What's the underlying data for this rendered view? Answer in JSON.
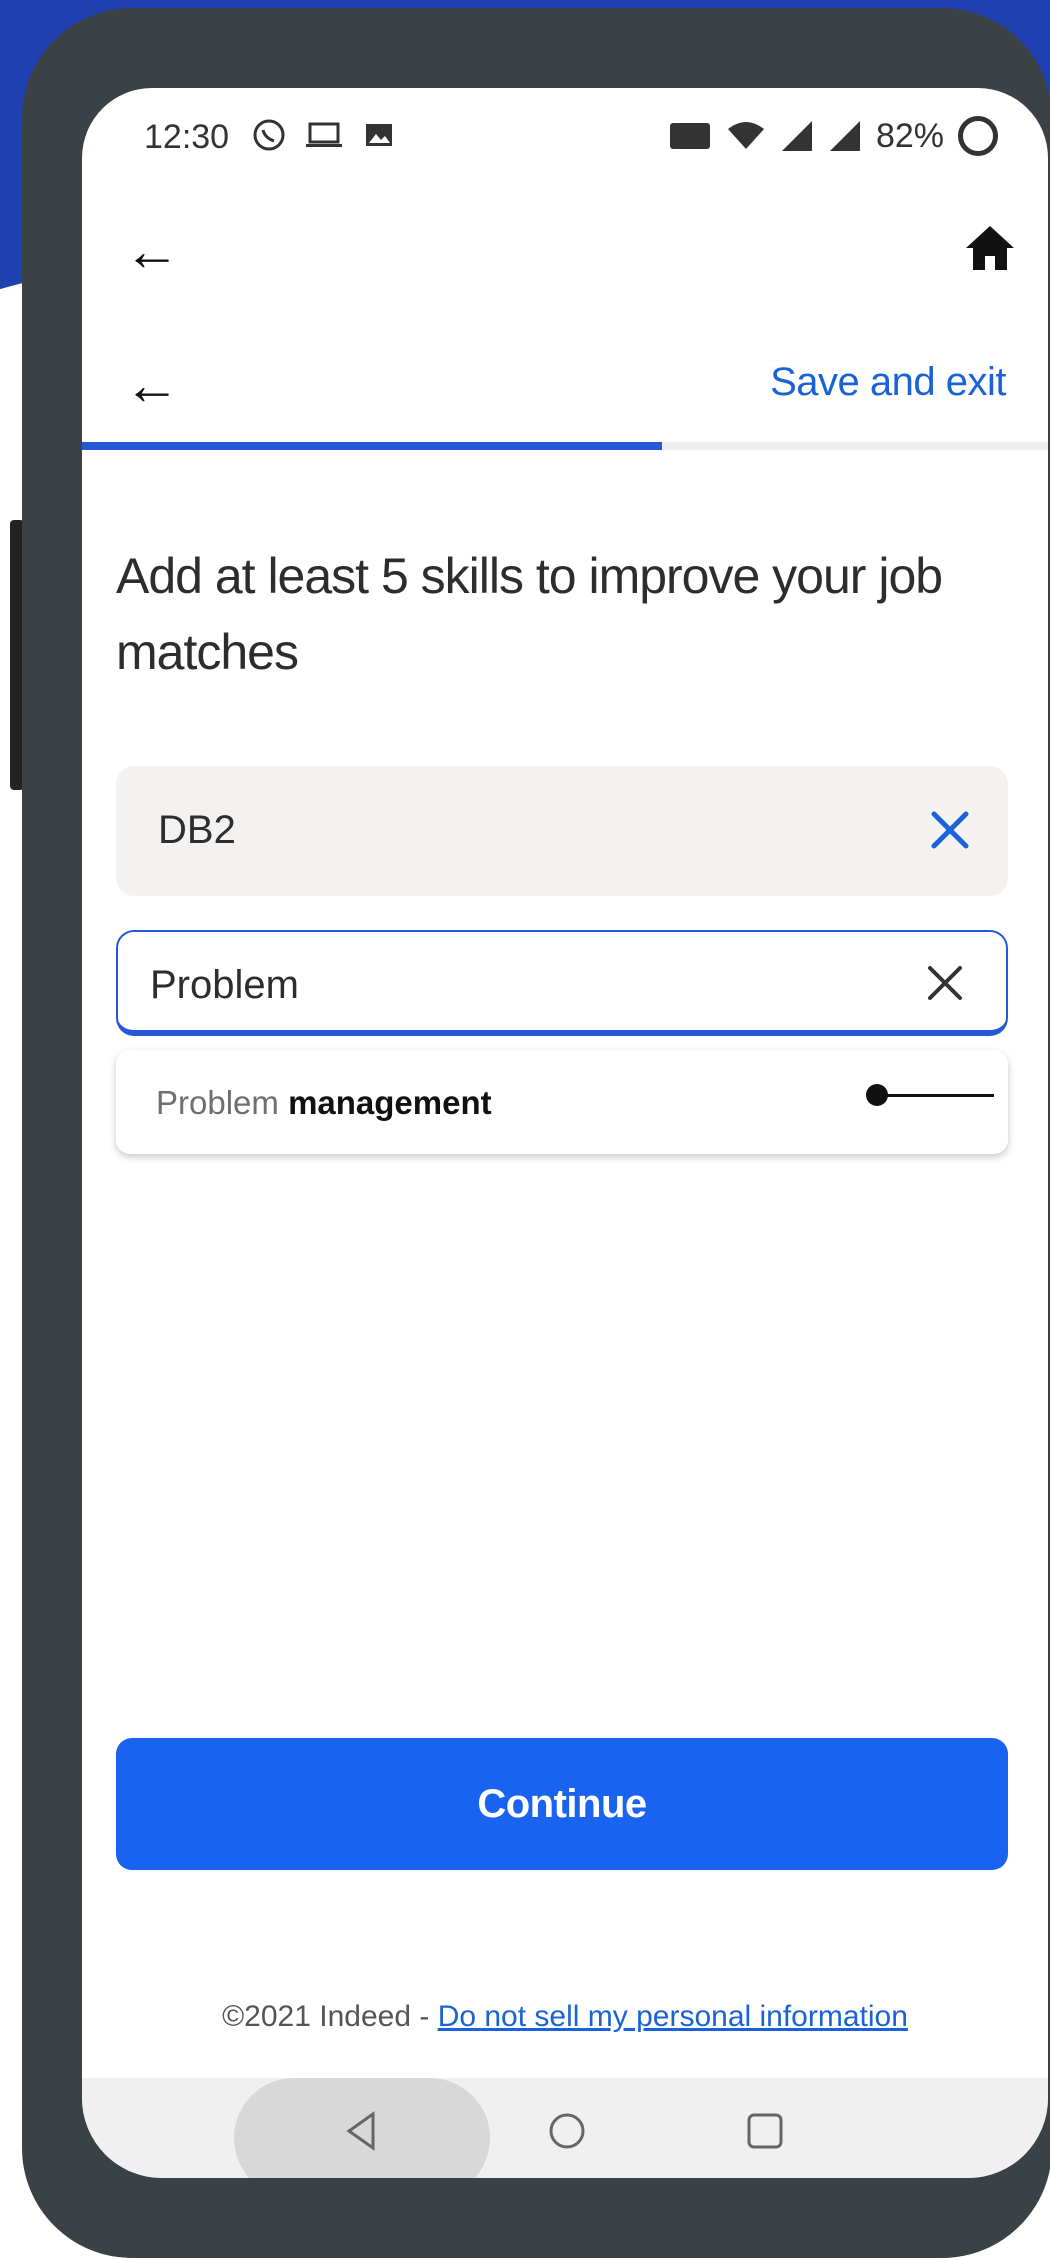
{
  "status_bar": {
    "time": "12:30",
    "battery": "82%"
  },
  "nav": {
    "save_exit_label": "Save and exit",
    "progress_fraction": 0.6
  },
  "heading": "Add at least 5 skills to improve your job matches",
  "skills": [
    {
      "label": "DB2"
    }
  ],
  "search": {
    "value": "Problem",
    "placeholder": ""
  },
  "suggestion": {
    "prefix": "Problem",
    "match": "management"
  },
  "continue_label": "Continue",
  "footer": {
    "copyright": "©2021 Indeed - ",
    "link": "Do not sell my personal information"
  },
  "colors": {
    "accent": "#1a63f0",
    "link": "#1a63d6",
    "progress": "#2557d6",
    "chip_bg": "#f3f2f1"
  }
}
